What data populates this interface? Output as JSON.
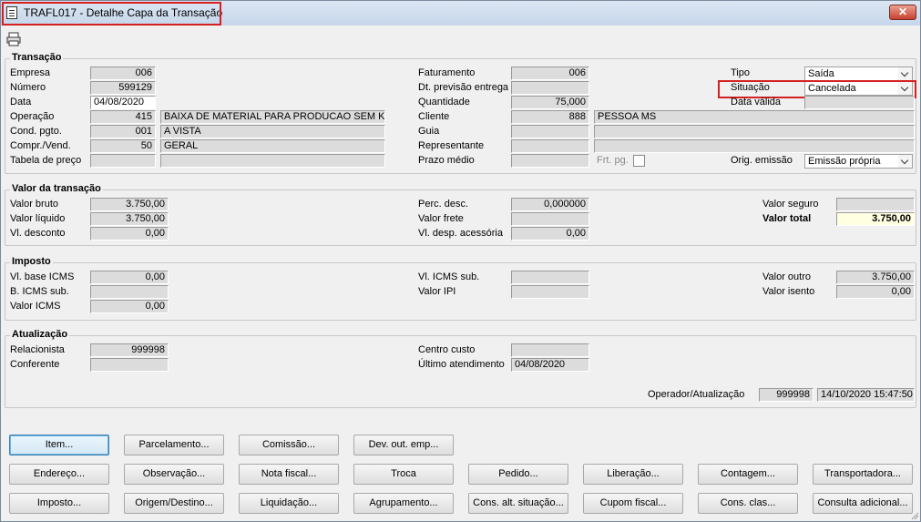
{
  "window": {
    "title": "TRAFL017 - Detalhe Capa da Transação",
    "close_label": "✕"
  },
  "transacao": {
    "legend": "Transação",
    "empresa_label": "Empresa",
    "empresa": "006",
    "numero_label": "Número",
    "numero": "599129",
    "data_label": "Data",
    "data": "04/08/2020",
    "operacao_label": "Operação",
    "operacao_code": "415",
    "operacao_desc": "BAIXA DE MATERIAL PARA PRODUCAO SEM KAR",
    "cond_label": "Cond. pgto.",
    "cond_code": "001",
    "cond_desc": "A VISTA",
    "compr_label": "Compr./Vend.",
    "compr_code": "50",
    "compr_desc": "GERAL",
    "tabela_label": "Tabela de preço",
    "faturamento_label": "Faturamento",
    "faturamento": "006",
    "dtprev_label": "Dt. previsão entrega",
    "quantidade_label": "Quantidade",
    "quantidade": "75,000",
    "cliente_label": "Cliente",
    "cliente_code": "888",
    "cliente_desc": "PESSOA MS",
    "guia_label": "Guia",
    "representante_label": "Representante",
    "prazo_label": "Prazo médio",
    "frt_label": "Frt. pg.",
    "tipo_label": "Tipo",
    "tipo": "Saída",
    "situacao_label": "Situação",
    "situacao": "Cancelada",
    "datavalida_label": "Data válida",
    "orig_label": "Orig. emissão",
    "orig": "Emissão própria"
  },
  "valor": {
    "legend": "Valor da transação",
    "bruto_label": "Valor bruto",
    "bruto": "3.750,00",
    "liquido_label": "Valor líquido",
    "liquido": "3.750,00",
    "desconto_label": "Vl. desconto",
    "desconto": "0,00",
    "percdesc_label": "Perc. desc.",
    "percdesc": "0,000000",
    "frete_label": "Valor frete",
    "despacess_label": "Vl. desp. acessória",
    "despacess": "0,00",
    "seguro_label": "Valor seguro",
    "total_label": "Valor total",
    "total": "3.750,00"
  },
  "imposto": {
    "legend": "Imposto",
    "baseicms_label": "Vl. base ICMS",
    "baseicms": "0,00",
    "bicmssub_label": "B. ICMS sub.",
    "valoricms_label": "Valor ICMS",
    "valoricms": "0,00",
    "icmssub_label": "Vl. ICMS sub.",
    "ipi_label": "Valor IPI",
    "outro_label": "Valor outro",
    "outro": "3.750,00",
    "isento_label": "Valor isento",
    "isento": "0,00"
  },
  "atualizacao": {
    "legend": "Atualização",
    "relacionista_label": "Relacionista",
    "relacionista": "999998",
    "conferente_label": "Conferente",
    "centro_label": "Centro custo",
    "ultimo_label": "Último atendimento",
    "ultimo": "04/08/2020",
    "operador_label": "Operador/Atualização",
    "operador": "999998",
    "operador_data": "14/10/2020 15:47:50"
  },
  "buttons": {
    "row1": [
      "Item...",
      "Parcelamento...",
      "Comissão...",
      "Dev. out. emp..."
    ],
    "row2": [
      "Endereço...",
      "Observação...",
      "Nota fiscal...",
      "Troca",
      "Pedido...",
      "Liberação...",
      "Contagem...",
      "Transportadora..."
    ],
    "row3": [
      "Imposto...",
      "Origem/Destino...",
      "Liquidação...",
      "Agrupamento...",
      "Cons. alt. situação...",
      "Cupom fiscal...",
      "Cons. clas...",
      "Consulta adicional..."
    ]
  }
}
